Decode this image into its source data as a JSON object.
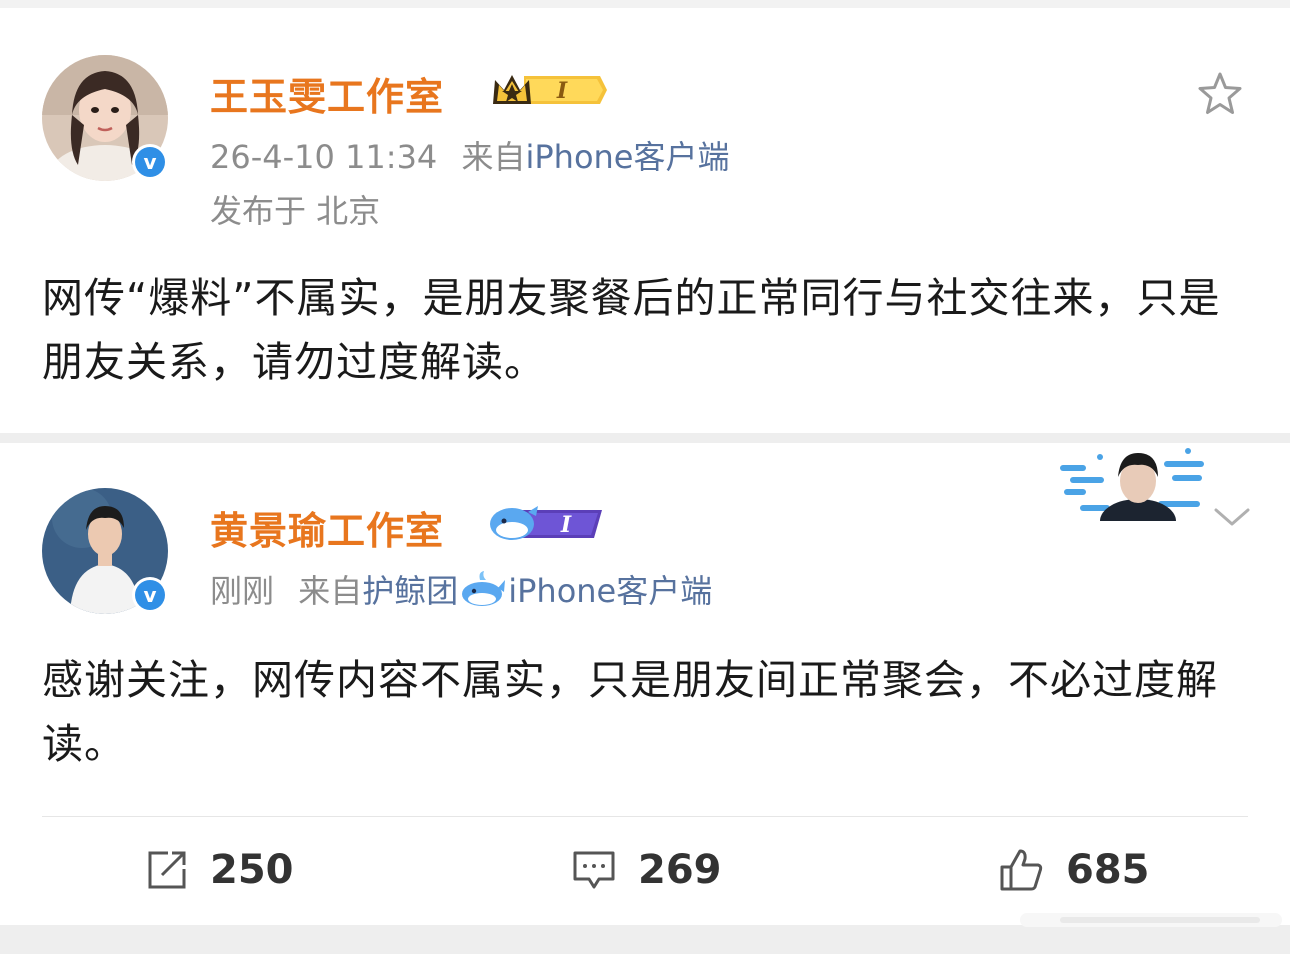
{
  "post1": {
    "username": "王玉雯工作室",
    "badge_level": "I",
    "timestamp": "26-4-10 11:34",
    "source_prefix": "来自",
    "source": "iPhone客户端",
    "location": "发布于 北京",
    "text": "网传“爆料”不属实，是朋友聚餐后的正常同行与社交往来，只是朋友关系，请勿过度解读。"
  },
  "post2": {
    "username": "黄景瑜工作室",
    "badge_level": "I",
    "timestamp": "刚刚",
    "source_prefix": "来自",
    "source_group": "护鲸团",
    "source": "iPhone客户端",
    "text": "感谢关注，网传内容不属实，只是朋友间正常聚会，不必过度解读。",
    "actions": {
      "repost_count": "250",
      "comment_count": "269",
      "like_count": "685"
    }
  },
  "colors": {
    "username": "#e8761e",
    "link": "#57729e",
    "verified": "#2f8fe6",
    "meta": "#8c8c8c"
  },
  "icons": [
    "star-icon",
    "chevron-down-icon",
    "repost-icon",
    "comment-icon",
    "like-icon",
    "verified-icon",
    "crown-badge-icon",
    "whale-badge-icon"
  ]
}
